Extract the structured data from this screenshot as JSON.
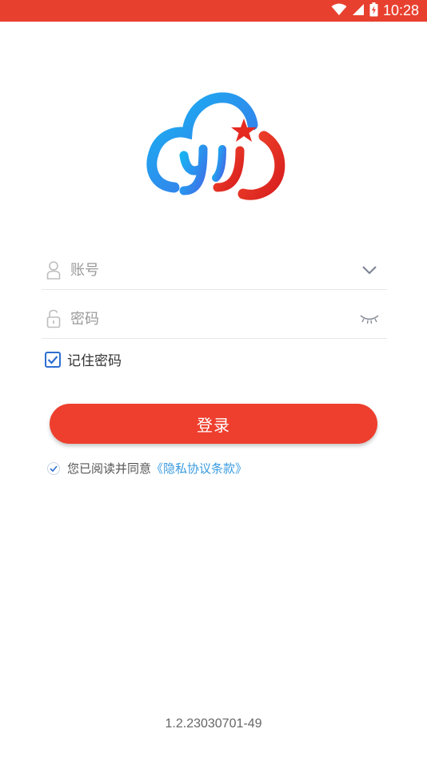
{
  "status_bar": {
    "time": "10:28",
    "background": "#e8402f",
    "icons": [
      "wifi-icon",
      "cell-signal-icon",
      "battery-charging-icon"
    ]
  },
  "logo": {
    "icon": "cloud-logo-icon",
    "colors": {
      "blue": "#1aa0ef",
      "red": "#e52a22",
      "star": "#e52a22"
    }
  },
  "form": {
    "account": {
      "placeholder": "账号",
      "value": "",
      "icon": "user-icon",
      "right_icon": "chevron-down-icon"
    },
    "password": {
      "placeholder": "密码",
      "value": "",
      "icon": "lock-icon",
      "right_icon": "eye-closed-icon"
    },
    "remember": {
      "label": "记住密码",
      "checked": true
    }
  },
  "login_button": {
    "label": "登录",
    "color": "#ee3f2e"
  },
  "agreement": {
    "checked": true,
    "text": "您已阅读并同意",
    "link": "《隐私协议条款》",
    "link_color": "#3a9be0"
  },
  "version": "1.2.23030701-49"
}
